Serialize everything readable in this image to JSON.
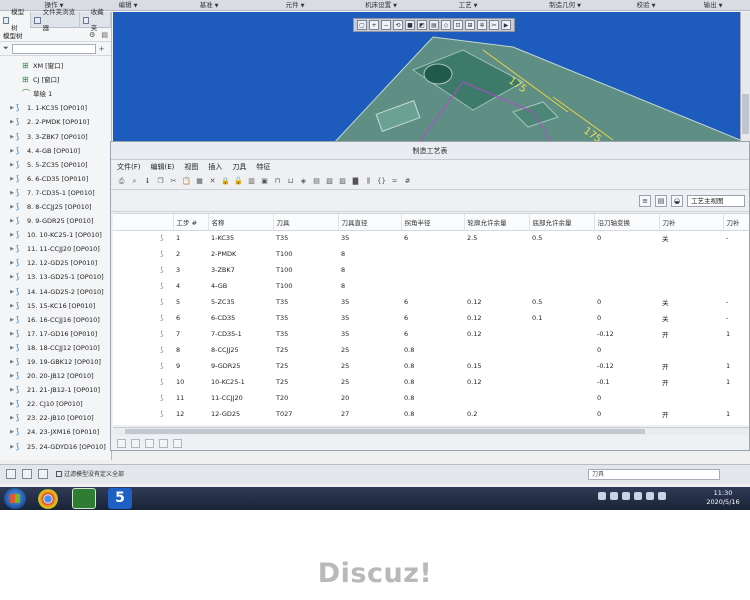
{
  "top_menu": [
    "操作",
    "编辑",
    "基准",
    "元件",
    "机床设置",
    "工艺",
    "制造几何",
    "校验",
    "输出"
  ],
  "tree_panel": {
    "tabs": [
      "模型树",
      "文件夹浏览器",
      "收藏夹"
    ],
    "toolbar_label": "模型树",
    "top_nodes": [
      "XM [窗口]",
      "CJ [窗口]",
      "草绘 1"
    ],
    "operations": [
      "1. 1-KC35 [OP010]",
      "2. 2-PMDK [OP010]",
      "3. 3-ZBK7 [OP010]",
      "4. 4-GB [OP010]",
      "5. 5-ZC35 [OP010]",
      "6. 6-CD35 [OP010]",
      "7. 7-CD35-1 [OP010]",
      "8. 8-CCJJ25 [OP010]",
      "9. 9-GDR25 [OP010]",
      "10. 10-KC25-1 [OP010]",
      "11. 11-CCJJ20 [OP010]",
      "12. 12-GD25 [OP010]",
      "13. 13-GD25-1 [OP010]",
      "14. 14-GD25-2 [OP010]",
      "15. 15-KC16 [OP010]",
      "16. 16-CCJJ16 [OP010]",
      "17. 17-GD16 [OP010]",
      "18. 18-CCJJ12 [OP010]",
      "19. 19-GBK12 [OP010]",
      "20. 20-JB12 [OP010]",
      "21. 21-JB12-1 [OP010]",
      "22. CJ10 [OP010]",
      "23. 22-JB10 [OP010]",
      "24. 23-JXM16 [OP010]",
      "25. 24-GDYD16 [OP010]"
    ]
  },
  "viewport": {
    "dimension_labels": [
      "175",
      "175"
    ]
  },
  "dialog": {
    "title": "制造工艺表",
    "menu": [
      "文件(F)",
      "编辑(E)",
      "视图",
      "插入",
      "刀具",
      "特征"
    ],
    "view_select": "工艺主视图",
    "columns": [
      "",
      "工步 #",
      "名称",
      "刀具",
      "刀具直径",
      "拐角半径",
      "轮廓允许余量",
      "底部允许余量",
      "沿刀轴变换",
      "刀补",
      "刀补"
    ],
    "rows": [
      [
        "1",
        "1-KC35",
        "T35",
        "35",
        "6",
        "2.5",
        "0.5",
        "0",
        "关",
        "-"
      ],
      [
        "2",
        "2-PMDK",
        "T100",
        "8",
        "",
        "",
        "",
        "",
        "",
        ""
      ],
      [
        "3",
        "3-ZBK7",
        "T100",
        "8",
        "",
        "",
        "",
        "",
        "",
        ""
      ],
      [
        "4",
        "4-GB",
        "T100",
        "8",
        "",
        "",
        "",
        "",
        "",
        ""
      ],
      [
        "5",
        "5-ZC35",
        "T35",
        "35",
        "6",
        "0.12",
        "0.5",
        "0",
        "关",
        "-"
      ],
      [
        "6",
        "6-CD35",
        "T35",
        "35",
        "6",
        "0.12",
        "0.1",
        "0",
        "关",
        "-"
      ],
      [
        "7",
        "7-CD35-1",
        "T35",
        "35",
        "6",
        "0.12",
        "",
        "-0.12",
        "开",
        "1"
      ],
      [
        "8",
        "8-CCJJ25",
        "T25",
        "25",
        "0.8",
        "",
        "",
        "0",
        "",
        ""
      ],
      [
        "9",
        "9-GDR25",
        "T25",
        "25",
        "0.8",
        "0.15",
        "",
        "-0.12",
        "开",
        "1"
      ],
      [
        "10",
        "10-KC25-1",
        "T25",
        "25",
        "0.8",
        "0.12",
        "",
        "-0.1",
        "开",
        "1"
      ],
      [
        "11",
        "11-CCJJ20",
        "T20",
        "20",
        "0.8",
        "",
        "",
        "0",
        "",
        ""
      ],
      [
        "12",
        "12-GD25",
        "T027",
        "27",
        "0.8",
        "0.2",
        "",
        "0",
        "开",
        "1"
      ]
    ]
  },
  "status": {
    "message": "过滤模型没有定义全部",
    "filter": "刀具"
  },
  "taskbar": {
    "time": "11:30",
    "date": "2020/5/16",
    "app_label": "5"
  },
  "watermark": "Discuz!"
}
